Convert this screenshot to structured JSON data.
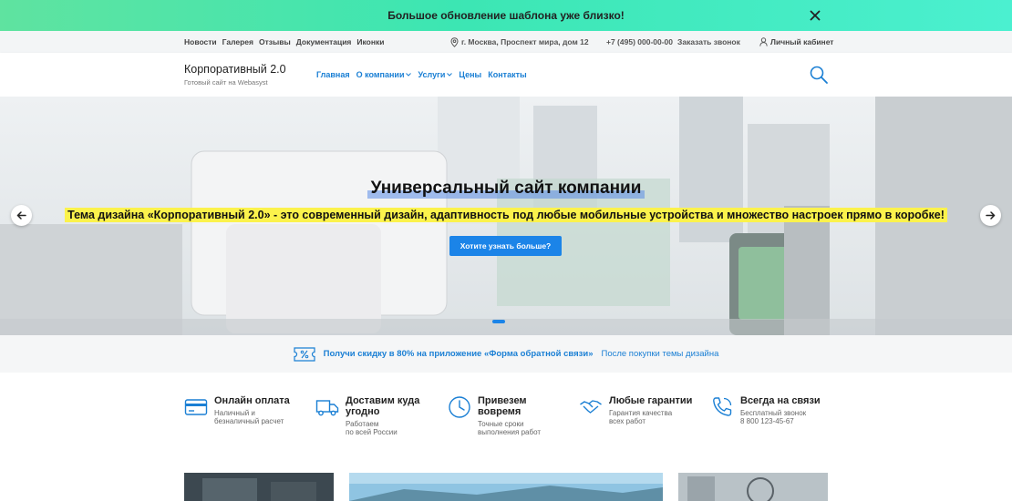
{
  "announcement": {
    "text": "Большое обновление шаблона уже близко!",
    "close_icon": "close-icon"
  },
  "topbar": {
    "nav": [
      "Новости",
      "Галерея",
      "Отзывы",
      "Документация",
      "Иконки"
    ],
    "address": "г. Москва, Проспект мира, дом 12",
    "phone": "+7 (495) 000-00-00",
    "callback": "Заказать звонок",
    "account": "Личный кабинет"
  },
  "header": {
    "brand_title": "Корпоративный 2.0",
    "brand_subtitle": "Готовый сайт на Webasyst",
    "nav": [
      {
        "label": "Главная",
        "dropdown": false
      },
      {
        "label": "О компании",
        "dropdown": true
      },
      {
        "label": "Услуги",
        "dropdown": true
      },
      {
        "label": "Цены",
        "dropdown": false
      },
      {
        "label": "Контакты",
        "dropdown": false
      }
    ],
    "search_icon": "search-icon"
  },
  "hero": {
    "title": "Универсальный сайт компании",
    "subtitle": "Тема дизайна «Корпоративный 2.0» - это современный дизайн, адаптивность под любые мобильные устройства и множество настроек прямо в коробке!",
    "cta": "Хотите узнать больше?",
    "prev_icon": "arrow-left-icon",
    "next_icon": "arrow-right-icon"
  },
  "promo": {
    "main": "Получи скидку в 80% на приложение «Форма обратной связи»",
    "note": "После покупки темы дизайна",
    "icon": "discount-ticket-icon"
  },
  "features": [
    {
      "title": "Онлайн оплата",
      "desc": "Наличный и\nбезналичный расчет",
      "icon": "credit-card-icon"
    },
    {
      "title": "Доставим куда\nугодно",
      "desc": "Работаем\nпо всей России",
      "icon": "truck-icon"
    },
    {
      "title": "Привезем\nвовремя",
      "desc": "Точные сроки\nвыполнения работ",
      "icon": "clock-icon"
    },
    {
      "title": "Любые гарантии",
      "desc": "Гарантия качества\nвсех работ",
      "icon": "handshake-icon"
    },
    {
      "title": "Всегда на связи",
      "desc": "Бесплатный звонок\n8 800 123-45-67",
      "icon": "phone-icon"
    }
  ],
  "colors": {
    "accent": "#1b84e8",
    "link": "#1a7fd4",
    "highlight": "#fbf24c",
    "banner_start": "#5fe3a0",
    "banner_end": "#4bf0d0"
  }
}
